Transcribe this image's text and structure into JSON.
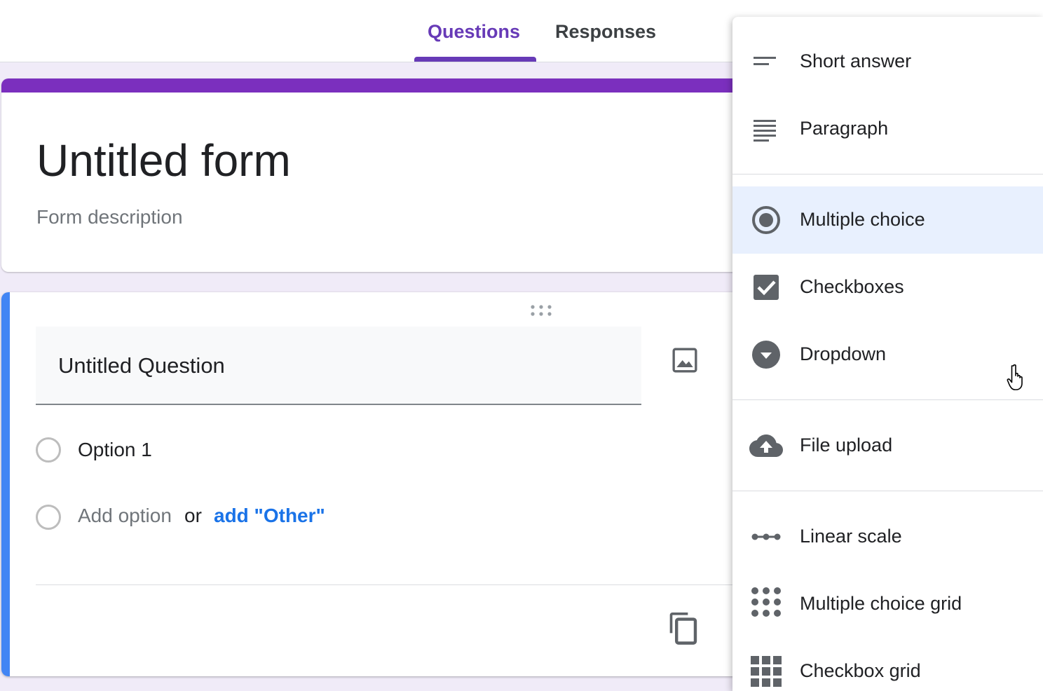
{
  "tabs": [
    {
      "label": "Questions",
      "active": true
    },
    {
      "label": "Responses",
      "active": false
    }
  ],
  "form": {
    "title": "Untitled form",
    "description": "Form description",
    "accent_color": "#673ab7"
  },
  "question": {
    "title": "Untitled Question",
    "options": [
      {
        "label": "Option 1"
      }
    ],
    "add_option": "Add option",
    "or": "or",
    "add_other": "add \"Other\""
  },
  "question_type_menu": {
    "items": [
      {
        "label": "Short answer",
        "icon": "short-answer-icon"
      },
      {
        "label": "Paragraph",
        "icon": "paragraph-icon"
      },
      {
        "label": "Multiple choice",
        "icon": "radio-button-icon",
        "selected": true
      },
      {
        "label": "Checkboxes",
        "icon": "checkbox-icon"
      },
      {
        "label": "Dropdown",
        "icon": "dropdown-circle-icon"
      },
      {
        "label": "File upload",
        "icon": "cloud-upload-icon"
      },
      {
        "label": "Linear scale",
        "icon": "linear-scale-icon"
      },
      {
        "label": "Multiple choice grid",
        "icon": "dots-grid-icon"
      },
      {
        "label": "Checkbox grid",
        "icon": "squares-grid-icon"
      }
    ],
    "highlight_color": "#e8f0fe"
  }
}
